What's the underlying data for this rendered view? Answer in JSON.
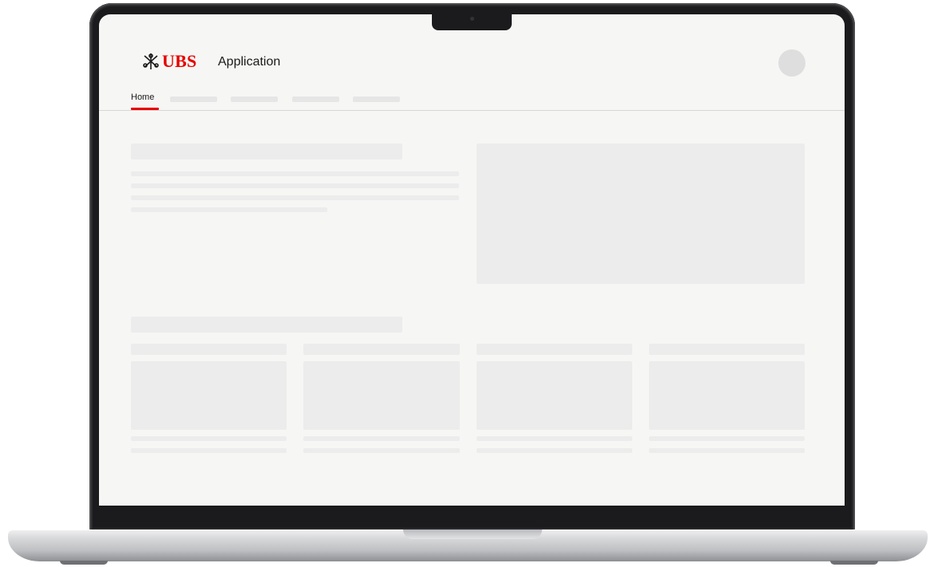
{
  "app": {
    "brand_name": "UBS",
    "title": "Application",
    "brand_color": "#e60000"
  },
  "nav": {
    "active_tab": "Home",
    "placeholder_tab_count": 4
  },
  "icons": {
    "logo": "ubs-keys-icon",
    "avatar": "user-avatar"
  },
  "colors": {
    "screen_background": "#f6f6f4",
    "skeleton": "#ececec",
    "accent": "#e60000"
  }
}
